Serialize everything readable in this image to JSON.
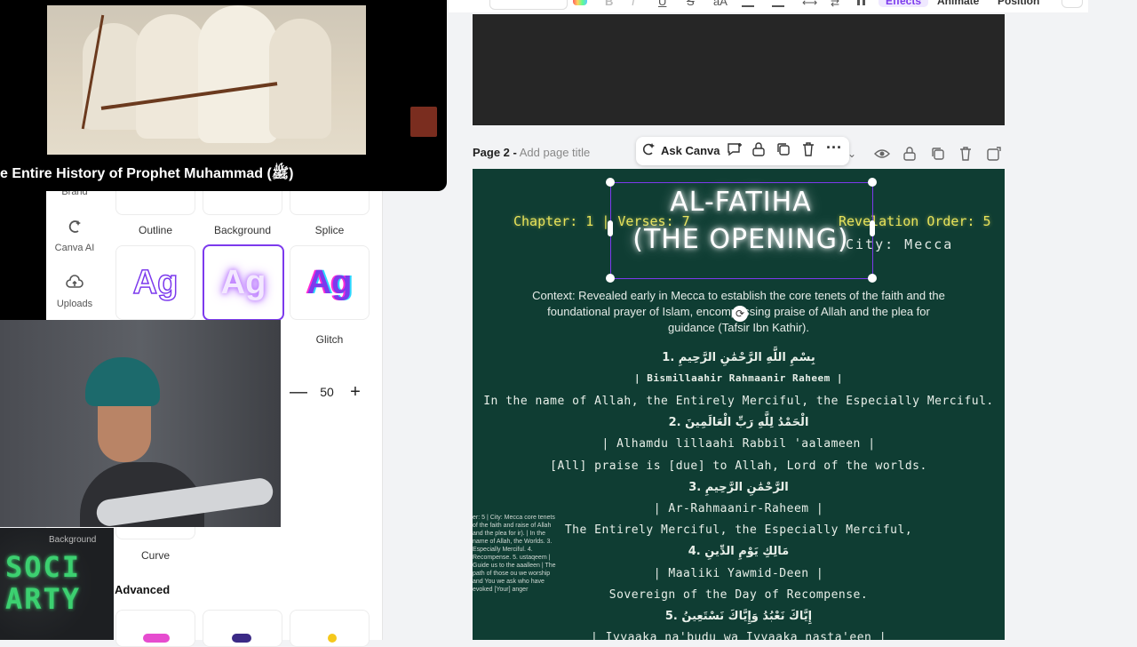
{
  "video": {
    "title": "e Entire History of Prophet Muhammad (ﷺ)"
  },
  "rail": [
    {
      "label": "Brand",
      "icon": "brand-icon"
    },
    {
      "label": "Canva AI",
      "icon": "canva-ai-icon"
    },
    {
      "label": "Uploads",
      "icon": "cloud-upload-icon"
    },
    {
      "label": "Background",
      "icon": "background-icon"
    }
  ],
  "effects": {
    "row1": [
      "Outline",
      "Background",
      "Splice"
    ],
    "row2_sample": "Ag",
    "row2_label": "Glitch",
    "curve_label": "Curve",
    "advanced_label": "Advanced",
    "stepper_value": "50",
    "stepper_minus": "—",
    "stepper_plus": "+"
  },
  "toolbar": {
    "effects_label": "Effects",
    "animate_label": "Animate",
    "position_label": "Position"
  },
  "page2": {
    "header_prefix": "Page 2 -",
    "header_placeholder": "Add page title",
    "ask_canva": "Ask Canva",
    "title_line1": "AL-FATIHA",
    "title_line2": "(THE OPENING)",
    "chapter_info": "Chapter: 1 | Verses: 7",
    "revelation_order": "Revelation Order: 5",
    "city": "City: Mecca",
    "context": "Context: Revealed early in Mecca to establish the core tenets of the faith and the foundational prayer of Islam, encompassing praise of Allah and the plea for guidance (Tafsir Ibn Kathir).",
    "verses": [
      {
        "arabic": "1. بِسْمِ اللَّهِ الرَّحْمَٰنِ الرَّحِيمِ",
        "translit": "| Bismillaahir Rahmaanir Raheem |",
        "english": "In the name of Allah, the Entirely Merciful, the Especially Merciful."
      },
      {
        "arabic": "2. الْحَمْدُ لِلَّهِ رَبِّ الْعَالَمِينَ",
        "translit": "| Alhamdu lillaahi Rabbil 'aalameen |",
        "english": "[All] praise is [due] to Allah, Lord of the worlds."
      },
      {
        "arabic": "3. الرَّحْمَٰنِ الرَّحِيمِ",
        "translit": "| Ar-Rahmaanir-Raheem |",
        "english": "The Entirely Merciful, the Especially Merciful,"
      },
      {
        "arabic": "4. مَالِكِ يَوْمِ الدِّينِ",
        "translit": "| Maaliki Yawmid-Deen |",
        "english": "Sovereign of the Day of Recompense."
      },
      {
        "arabic": "5. إِيَّاكَ نَعْبُدُ وَإِيَّاكَ نَسْتَعِينُ",
        "translit": "| Iyyaaka na'budu wa Iyyaaka nasta'een |"
      }
    ],
    "thumbnail_text": "er: 5 | City: Mecca core tenets of the faith and raise of Allah and the plea for ir). | In the name of Allah, the Worlds. 3. Especially Merciful. 4. Recompense. 5. ustaqeem | Guide us to the aaalleen | The path of those ou we worship and You we ask who have evoked [Your] anger"
  },
  "logo": {
    "text": "SOCI ARTY",
    "color": "#3cd070"
  },
  "colors": {
    "canvas_bg": "#0f3d33",
    "accent": "#7c3aed",
    "title_glow": "#ffffff",
    "chapter_yellow": "#e8e35a"
  }
}
